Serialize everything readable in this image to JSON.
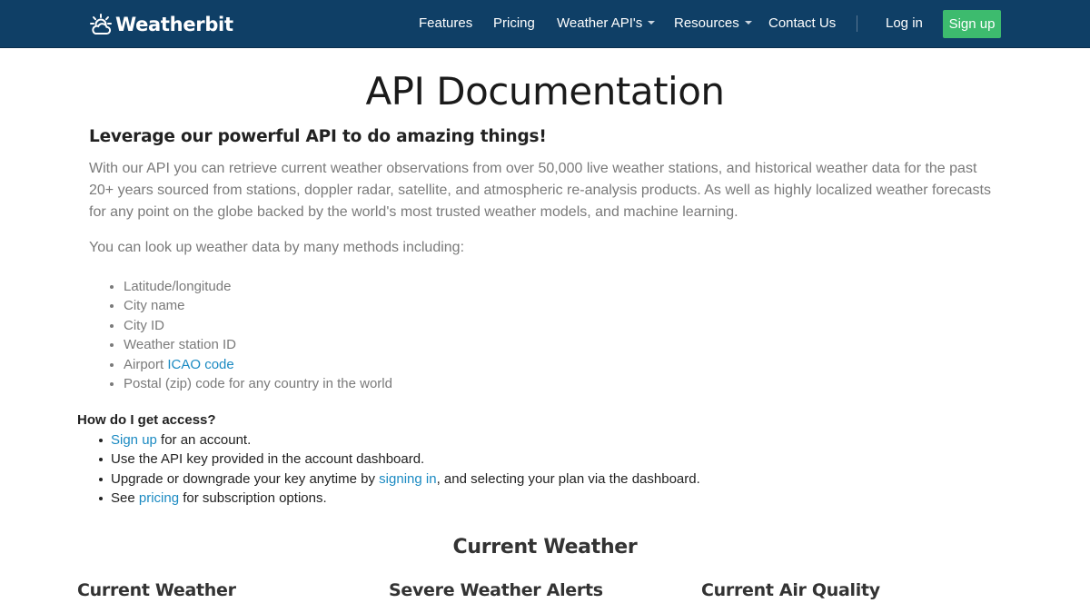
{
  "nav": {
    "brand": "Weatherbit",
    "items": [
      {
        "label": "Features",
        "dropdown": false
      },
      {
        "label": "Pricing",
        "dropdown": false
      },
      {
        "label": "Weather API's",
        "dropdown": true
      },
      {
        "label": "Resources",
        "dropdown": true
      },
      {
        "label": "Contact Us",
        "dropdown": false
      }
    ],
    "login": "Log in",
    "signup": "Sign up"
  },
  "page": {
    "title": "API Documentation",
    "lead": "Leverage our powerful API to do amazing things!",
    "description": "With our API you can retrieve current weather observations from over 50,000 live weather stations, and historical weather data for the past 20+ years sourced from stations, doppler radar, satellite, and atmospheric re-analysis products. As well as highly localized weather forecasts for any point on the globe backed by the world's most trusted weather models, and machine learning.",
    "methods_intro": "You can look up weather data by many methods including:",
    "methods": [
      "Latitude/longitude",
      "City name",
      "City ID",
      "Weather station ID",
      {
        "prefix": "Airport ",
        "link": "ICAO code"
      },
      "Postal (zip) code for any country in the world"
    ]
  },
  "access": {
    "title": "How do I get access?",
    "items": [
      {
        "link": "Sign up",
        "after": " for an account."
      },
      {
        "text": "Use the API key provided in the account dashboard."
      },
      {
        "before": "Upgrade or downgrade your key anytime by ",
        "link": "signing in",
        "after": ", and selecting your plan via the dashboard."
      },
      {
        "before": "See ",
        "link": "pricing",
        "after": " for subscription options."
      }
    ]
  },
  "section": {
    "title": "Current Weather",
    "cards": [
      "Current Weather",
      "Severe Weather Alerts",
      "Current Air Quality"
    ]
  },
  "colors": {
    "navbar": "#0f3f66",
    "signup_button": "#3dbb6e",
    "link": "#1b8ac2",
    "muted_text": "#7a7a7a"
  },
  "icons": {
    "brand": "sun-behind-cloud-icon"
  }
}
